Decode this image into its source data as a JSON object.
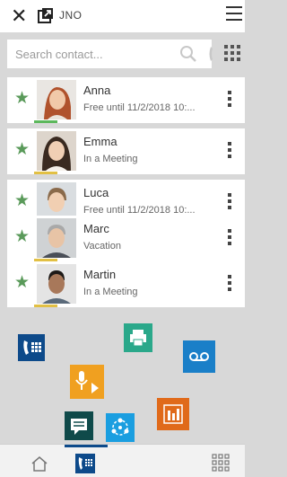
{
  "header": {
    "title": "JNO",
    "close_icon": "close-icon",
    "transfer_icon": "export-icon",
    "menu_icon": "hamburger-icon"
  },
  "search": {
    "placeholder": "Search contact..."
  },
  "colors": {
    "favorite": "#5a9a5a",
    "accent_blue": "#0d4a8a",
    "status_green": "#5cb85c",
    "status_yellow": "#e2c044"
  },
  "contacts": [
    {
      "name": "Anna",
      "status": "Free until 11/2/2018 10:...",
      "avatar": "avatar-anna",
      "favorite": true
    },
    {
      "name": "Emma",
      "status": "In a Meeting",
      "avatar": "avatar-emma",
      "favorite": true
    },
    {
      "name": "Luca",
      "status": "Free until 11/2/2018 10:...",
      "avatar": "avatar-luca",
      "favorite": true
    },
    {
      "name": "Marc",
      "status": "Vacation",
      "avatar": "avatar-marc",
      "favorite": true
    },
    {
      "name": "Martin",
      "status": "In a Meeting",
      "avatar": "avatar-martin",
      "favorite": true
    }
  ],
  "quick_actions": [
    {
      "icon": "phone-dialpad-icon",
      "color": "#0d4a8a"
    },
    {
      "icon": "print-icon",
      "color": "#2aa88a"
    },
    {
      "icon": "voicemail-icon",
      "color": "#1a7fc8"
    },
    {
      "icon": "microphone-icon",
      "color": "#f0a020"
    },
    {
      "icon": "message-icon",
      "color": "#0f4a4a"
    },
    {
      "icon": "network-icon",
      "color": "#1a9ee0"
    },
    {
      "icon": "report-chart-icon",
      "color": "#e06a1a"
    }
  ],
  "bottom_nav": [
    {
      "icon": "home-icon"
    },
    {
      "icon": "phone-dialpad-icon"
    },
    {
      "icon": "grid-icon"
    }
  ]
}
